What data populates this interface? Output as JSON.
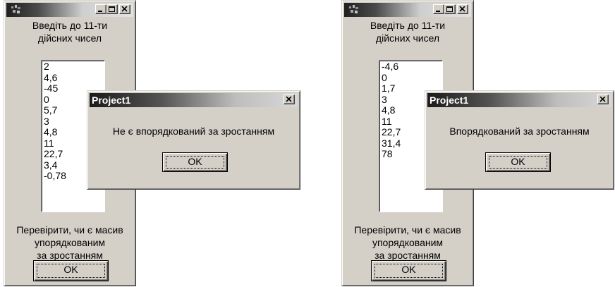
{
  "left": {
    "instruction": [
      "Введіть до 11-ти",
      "дійсних чисел"
    ],
    "values": [
      "2",
      "4,6",
      "-45",
      "0",
      "5,7",
      "3",
      "4,8",
      "11",
      "22,7",
      "3,4",
      "-0,78"
    ],
    "check_label": [
      "Перевірити, чи є масив",
      "упорядкованим",
      "за зростанням"
    ],
    "button": "OK",
    "dialog": {
      "title": "Project1",
      "message": "Не є впорядкований за зростанням",
      "button": "OK"
    }
  },
  "right": {
    "instruction": [
      "Введіть до 11-ти",
      "дійсних чисел"
    ],
    "values": [
      "-4,6",
      "0",
      "1,7",
      "3",
      "4,8",
      "11",
      "22,7",
      "31,4",
      "78"
    ],
    "check_label": [
      "Перевірити, чи є масив",
      "упорядкованим",
      "за зростанням"
    ],
    "button": "OK",
    "dialog": {
      "title": "Project1",
      "message": "Впорядкований за зростанням",
      "button": "OK"
    }
  },
  "colors": {
    "face": "#d4d0c8",
    "title_dark": "#202020",
    "title_light": "#e2e2e2"
  }
}
